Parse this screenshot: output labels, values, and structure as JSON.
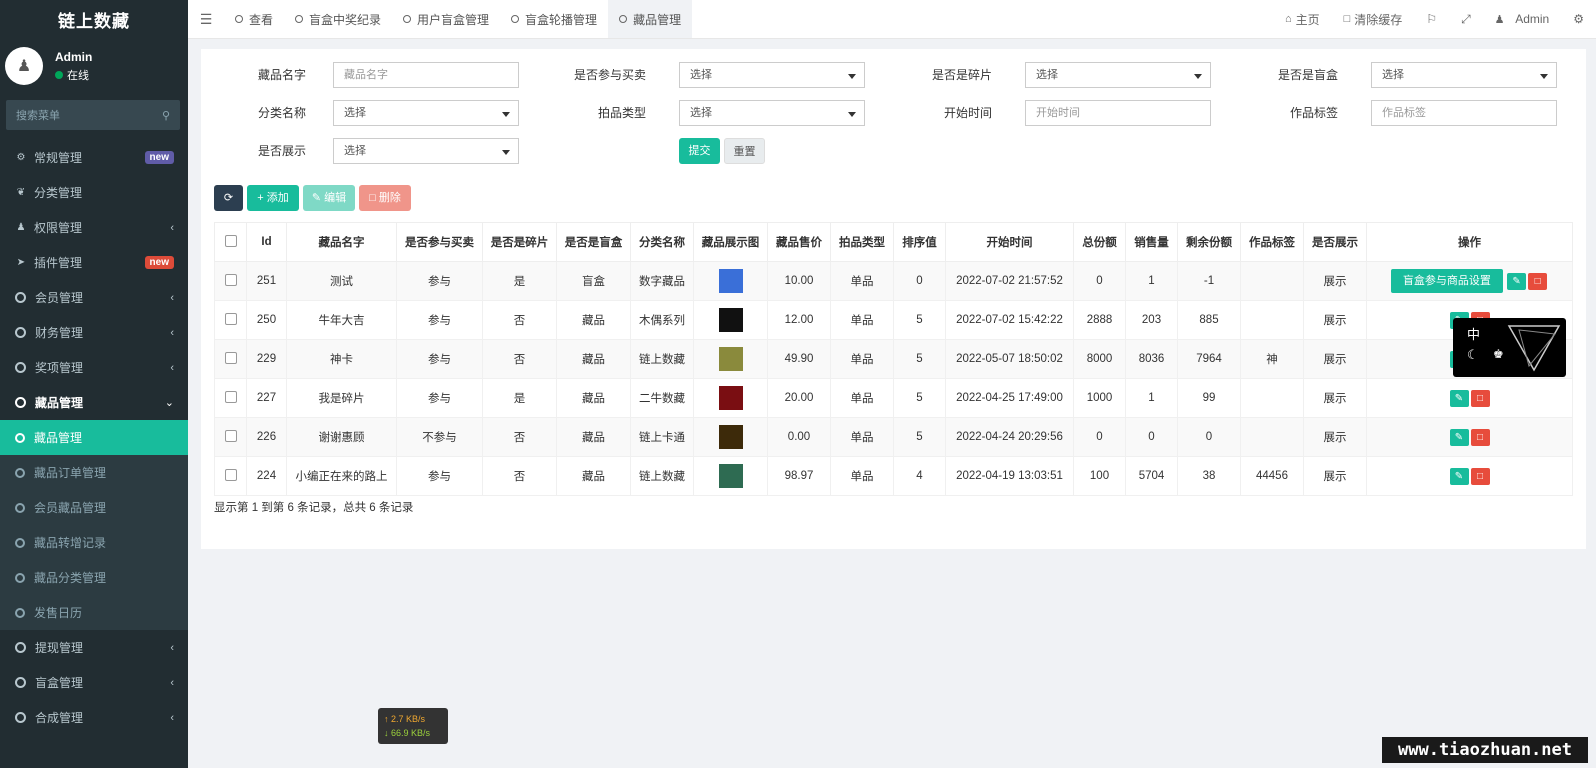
{
  "sidebar": {
    "logo": "链上数藏",
    "user": {
      "name": "Admin",
      "status": "在线"
    },
    "search_placeholder": "搜索菜单",
    "menu": [
      {
        "label": "常规管理",
        "badge": "new",
        "badge_color": "#605ca8"
      },
      {
        "label": "分类管理"
      },
      {
        "label": "权限管理"
      },
      {
        "label": "插件管理",
        "badge": "new",
        "badge_color": "#dd4b39"
      },
      {
        "label": "会员管理"
      },
      {
        "label": "财务管理"
      },
      {
        "label": "奖项管理"
      },
      {
        "label": "藏品管理"
      },
      {
        "label": "提现管理"
      },
      {
        "label": "盲盒管理"
      },
      {
        "label": "合成管理"
      }
    ],
    "submenu": [
      {
        "label": "藏品管理"
      },
      {
        "label": "藏品订单管理"
      },
      {
        "label": "会员藏品管理"
      },
      {
        "label": "藏品转增记录"
      },
      {
        "label": "藏品分类管理"
      },
      {
        "label": "发售日历"
      }
    ]
  },
  "topbar": {
    "tabs": [
      "查看",
      "盲盒中奖纪录",
      "用户盲盒管理",
      "盲盒轮播管理",
      "藏品管理"
    ],
    "home": "主页",
    "clear_cache": "清除缓存",
    "user": "Admin"
  },
  "filters": {
    "name_label": "藏品名字",
    "name_placeholder": "藏品名字",
    "buy_label": "是否参与买卖",
    "buy_value": "选择",
    "fragment_label": "是否是碎片",
    "fragment_value": "选择",
    "blindbox_label": "是否是盲盒",
    "blindbox_value": "选择",
    "category_label": "分类名称",
    "category_value": "选择",
    "auction_label": "拍品类型",
    "auction_value": "选择",
    "start_label": "开始时间",
    "start_placeholder": "开始时间",
    "tag_label": "作品标签",
    "tag_placeholder": "作品标签",
    "display_label": "是否展示",
    "display_value": "选择",
    "submit": "提交",
    "reset": "重置"
  },
  "toolbar": {
    "add": "添加",
    "edit": "编辑",
    "delete": "删除"
  },
  "table": {
    "headers": [
      "Id",
      "藏品名字",
      "是否参与买卖",
      "是否是碎片",
      "是否是盲盒",
      "分类名称",
      "藏品展示图",
      "藏品售价",
      "拍品类型",
      "排序值",
      "开始时间",
      "总份额",
      "销售量",
      "剩余份额",
      "作品标签",
      "是否展示",
      "操作"
    ],
    "rows": [
      {
        "id": "251",
        "name": "测试",
        "buy": "参与",
        "fragment": "是",
        "blindbox": "盲盒",
        "category": "数字藏品",
        "thumb_color": "#3a6fd8",
        "price": "10.00",
        "type": "单品",
        "sort": "0",
        "start": "2022-07-02 21:57:52",
        "total": "0",
        "sold": "1",
        "remain": "-1",
        "tag": "",
        "display": "展示",
        "op_wide": "盲盒参与商品设置"
      },
      {
        "id": "250",
        "name": "牛年大吉",
        "buy": "参与",
        "fragment": "否",
        "blindbox": "藏品",
        "category": "木偶系列",
        "thumb_color": "#111111",
        "price": "12.00",
        "type": "单品",
        "sort": "5",
        "start": "2022-07-02 15:42:22",
        "total": "2888",
        "sold": "203",
        "remain": "885",
        "tag": "",
        "display": "展示",
        "op_wide": ""
      },
      {
        "id": "229",
        "name": "神卡",
        "buy": "参与",
        "fragment": "否",
        "blindbox": "藏品",
        "category": "链上数藏",
        "thumb_color": "#8a8a3c",
        "price": "49.90",
        "type": "单品",
        "sort": "5",
        "start": "2022-05-07 18:50:02",
        "total": "8000",
        "sold": "8036",
        "remain": "7964",
        "tag": "神",
        "display": "展示",
        "op_wide": ""
      },
      {
        "id": "227",
        "name": "我是碎片",
        "buy": "参与",
        "fragment": "是",
        "blindbox": "藏品",
        "category": "二牛数藏",
        "thumb_color": "#7a0e12",
        "price": "20.00",
        "type": "单品",
        "sort": "5",
        "start": "2022-04-25 17:49:00",
        "total": "1000",
        "sold": "1",
        "remain": "99",
        "tag": "",
        "display": "展示",
        "op_wide": ""
      },
      {
        "id": "226",
        "name": "谢谢惠顾",
        "buy": "不参与",
        "fragment": "否",
        "blindbox": "藏品",
        "category": "链上卡通",
        "thumb_color": "#3d2a0a",
        "price": "0.00",
        "type": "单品",
        "sort": "5",
        "start": "2022-04-24 20:29:56",
        "total": "0",
        "sold": "0",
        "remain": "0",
        "tag": "",
        "display": "展示",
        "op_wide": ""
      },
      {
        "id": "224",
        "name": "小编正在来的路上",
        "buy": "参与",
        "fragment": "否",
        "blindbox": "藏品",
        "category": "链上数藏",
        "thumb_color": "#2e6b52",
        "price": "98.97",
        "type": "单品",
        "sort": "4",
        "start": "2022-04-19 13:03:51",
        "total": "100",
        "sold": "5704",
        "remain": "38",
        "tag": "44456",
        "display": "展示",
        "op_wide": ""
      }
    ]
  },
  "pagination": "显示第 1 到第 6 条记录，总共 6 条记录",
  "widget": {
    "lang": "中"
  },
  "net_speed": {
    "up": "↑ 2.7 KB/s",
    "down": "↓ 66.9 KB/s"
  },
  "watermark": "www.tiaozhuan.net"
}
